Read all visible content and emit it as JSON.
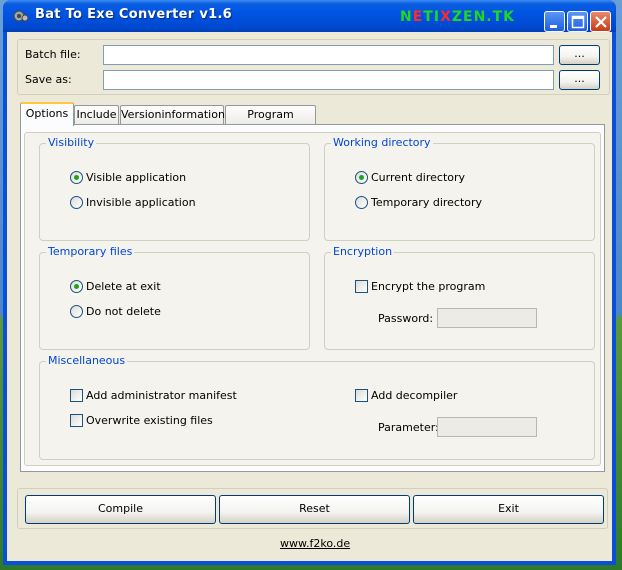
{
  "window": {
    "title": "Bat To Exe Converter v1.6",
    "brand_parts": [
      "N",
      "E",
      "TI",
      "X",
      "ZEN.TK"
    ]
  },
  "header": {
    "batch_file_label": "Batch file:",
    "batch_file_value": "",
    "save_as_label": "Save as:",
    "save_as_value": "",
    "browse_label": "..."
  },
  "tabs": [
    {
      "label": "Options",
      "active": true
    },
    {
      "label": "Include",
      "active": false
    },
    {
      "label": "Versioninformations",
      "active": false
    },
    {
      "label": "Program settings",
      "active": false
    }
  ],
  "visibility": {
    "title": "Visibility",
    "options": [
      {
        "label": "Visible application",
        "selected": true
      },
      {
        "label": "Invisible application",
        "selected": false
      }
    ]
  },
  "working_directory": {
    "title": "Working directory",
    "options": [
      {
        "label": "Current directory",
        "selected": true
      },
      {
        "label": "Temporary directory",
        "selected": false
      }
    ]
  },
  "temporary_files": {
    "title": "Temporary files",
    "options": [
      {
        "label": "Delete at exit",
        "selected": true
      },
      {
        "label": "Do not delete",
        "selected": false
      }
    ]
  },
  "encryption": {
    "title": "Encryption",
    "encrypt_label": "Encrypt the program",
    "encrypt_checked": false,
    "password_label": "Password:",
    "password_value": ""
  },
  "miscellaneous": {
    "title": "Miscellaneous",
    "admin_manifest_label": "Add administrator manifest",
    "overwrite_label": "Overwrite existing files",
    "decompiler_label": "Add decompiler",
    "parameter_label": "Parameter:",
    "parameter_value": ""
  },
  "actions": {
    "compile_label": "Compile",
    "reset_label": "Reset",
    "exit_label": "Exit"
  },
  "footer": {
    "link_text": "www.f2ko.de"
  },
  "colors": {
    "title_bar": "#0054e3",
    "group_title": "#0046d5",
    "brand_green": "#1fd81f",
    "brand_red": "#ff2a2a",
    "tab_highlight": "#ffc83c"
  }
}
